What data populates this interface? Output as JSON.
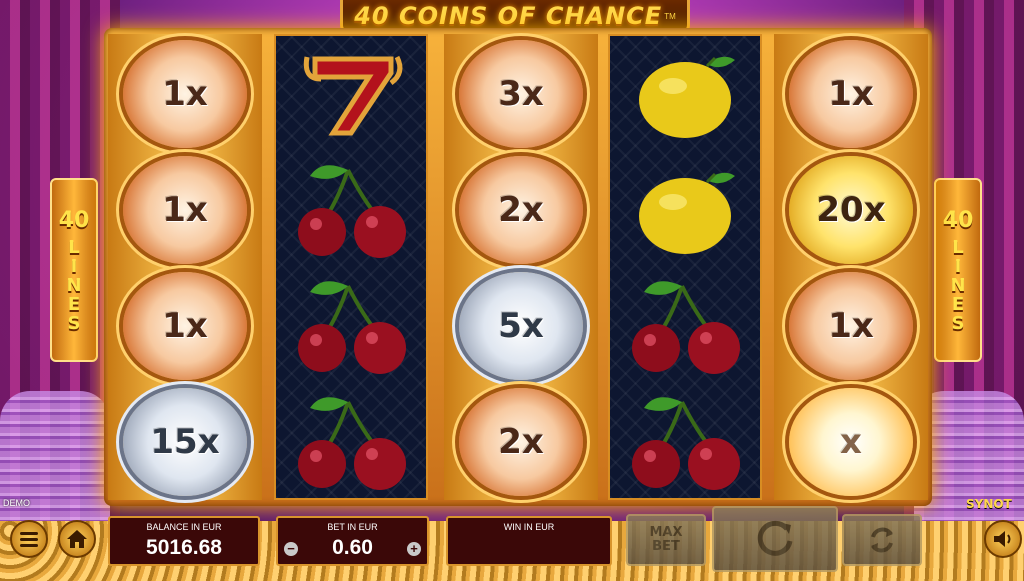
{
  "game": {
    "title": "40 COINS OF CHANCE",
    "trademark": "TM",
    "lines_number": "40",
    "lines_word": "LINES",
    "brand": "SYNOT",
    "mode": "DEMO"
  },
  "reels": [
    {
      "type": "coin",
      "cells": [
        {
          "kind": "coin",
          "tone": "bronze",
          "label": "1x"
        },
        {
          "kind": "coin",
          "tone": "bronze",
          "label": "1x"
        },
        {
          "kind": "coin",
          "tone": "bronze",
          "label": "1x"
        },
        {
          "kind": "coin",
          "tone": "silver",
          "label": "15x"
        }
      ]
    },
    {
      "type": "symbol",
      "cells": [
        {
          "kind": "symbol",
          "symbol": "seven-icon"
        },
        {
          "kind": "symbol",
          "symbol": "cherries-icon"
        },
        {
          "kind": "symbol",
          "symbol": "cherries-icon"
        },
        {
          "kind": "symbol",
          "symbol": "cherries-icon"
        }
      ]
    },
    {
      "type": "coin",
      "cells": [
        {
          "kind": "coin",
          "tone": "bronze",
          "label": "3x"
        },
        {
          "kind": "coin",
          "tone": "bronze",
          "label": "2x"
        },
        {
          "kind": "coin",
          "tone": "silver",
          "label": "5x"
        },
        {
          "kind": "coin",
          "tone": "bronze",
          "label": "2x"
        }
      ]
    },
    {
      "type": "symbol",
      "cells": [
        {
          "kind": "symbol",
          "symbol": "lemon-icon"
        },
        {
          "kind": "symbol",
          "symbol": "lemon-icon"
        },
        {
          "kind": "symbol",
          "symbol": "cherries-icon"
        },
        {
          "kind": "symbol",
          "symbol": "cherries-icon"
        }
      ]
    },
    {
      "type": "coin",
      "cells": [
        {
          "kind": "coin",
          "tone": "bronze",
          "label": "1x"
        },
        {
          "kind": "coin",
          "tone": "gold",
          "label": "20x"
        },
        {
          "kind": "coin",
          "tone": "bronze",
          "label": "1x"
        },
        {
          "kind": "coin",
          "tone": "flash",
          "label": "x"
        }
      ]
    }
  ],
  "controls": {
    "balance_label": "BALANCE IN EUR",
    "balance_value": "5016.68",
    "bet_label": "BET IN EUR",
    "bet_value": "0.60",
    "bet_minus": "−",
    "bet_plus": "+",
    "win_label": "WIN IN EUR",
    "win_value": "",
    "maxbet_line1": "MAX",
    "maxbet_line2": "BET"
  },
  "colors": {
    "frame_gold": "#f7b23b",
    "panel_bg": "#3b0808",
    "title_yellow": "#ffd84a"
  }
}
